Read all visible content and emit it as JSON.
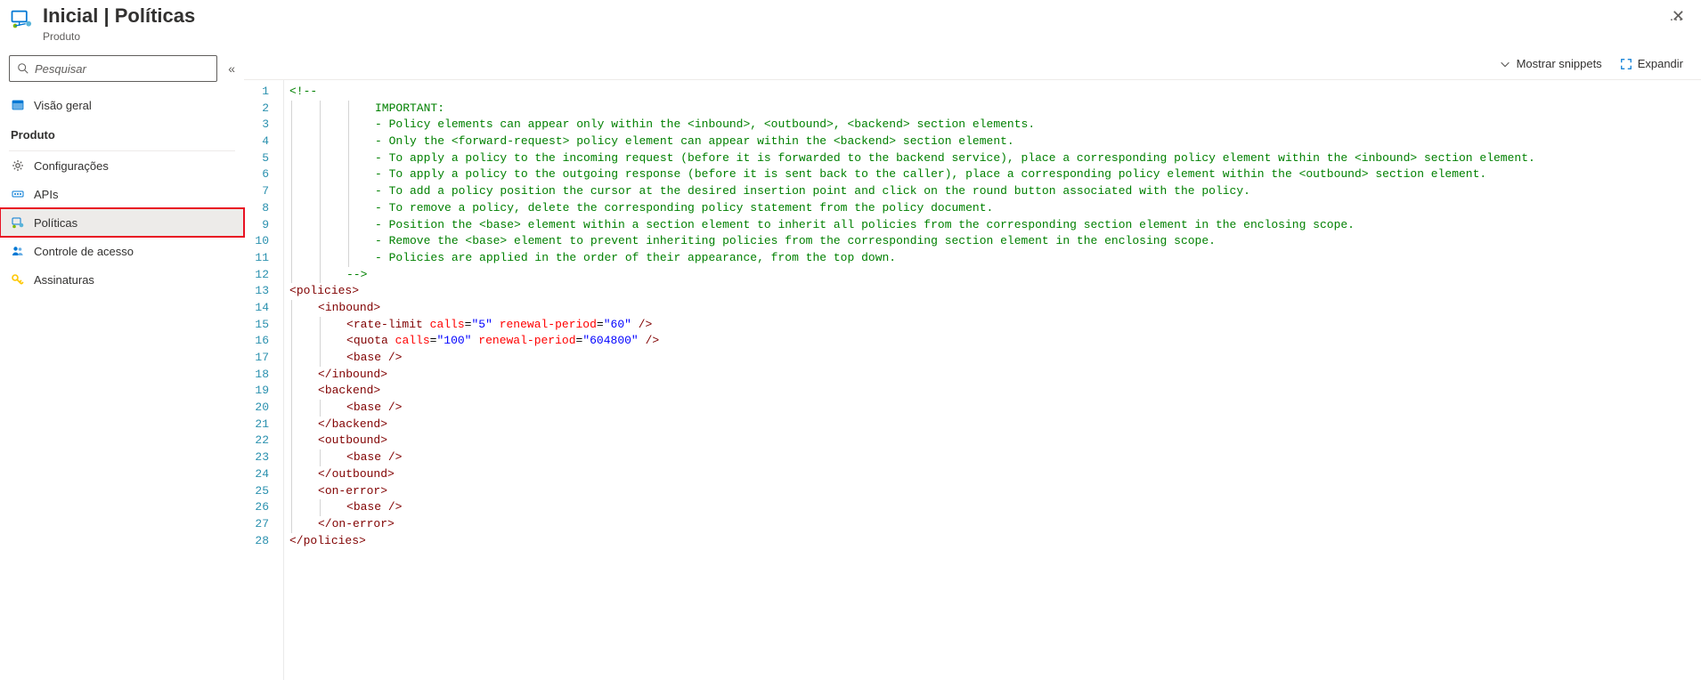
{
  "header": {
    "title": "Inicial | Políticas",
    "subtitle": "Produto",
    "more": "…"
  },
  "search": {
    "placeholder": "Pesquisar"
  },
  "sidebar": {
    "overview": "Visão geral",
    "sectionHeader": "Produto",
    "items": {
      "config": "Configurações",
      "apis": "APIs",
      "policies": "Políticas",
      "access": "Controle de acesso",
      "subs": "Assinaturas"
    }
  },
  "toolbar": {
    "snippets": "Mostrar snippets",
    "expand": "Expandir"
  },
  "editor": {
    "lineCount": 28,
    "lines": [
      {
        "indent": 0,
        "tokens": [
          {
            "t": "comment",
            "v": "<!--"
          }
        ]
      },
      {
        "indent": 3,
        "tokens": [
          {
            "t": "comment",
            "v": "IMPORTANT:"
          }
        ]
      },
      {
        "indent": 3,
        "tokens": [
          {
            "t": "comment",
            "v": "- Policy elements can appear only within the <inbound>, <outbound>, <backend> section elements."
          }
        ]
      },
      {
        "indent": 3,
        "tokens": [
          {
            "t": "comment",
            "v": "- Only the <forward-request> policy element can appear within the <backend> section element."
          }
        ]
      },
      {
        "indent": 3,
        "tokens": [
          {
            "t": "comment",
            "v": "- To apply a policy to the incoming request (before it is forwarded to the backend service), place a corresponding policy element within the <inbound> section element."
          }
        ]
      },
      {
        "indent": 3,
        "tokens": [
          {
            "t": "comment",
            "v": "- To apply a policy to the outgoing response (before it is sent back to the caller), place a corresponding policy element within the <outbound> section element."
          }
        ]
      },
      {
        "indent": 3,
        "tokens": [
          {
            "t": "comment",
            "v": "- To add a policy position the cursor at the desired insertion point and click on the round button associated with the policy."
          }
        ]
      },
      {
        "indent": 3,
        "tokens": [
          {
            "t": "comment",
            "v": "- To remove a policy, delete the corresponding policy statement from the policy document."
          }
        ]
      },
      {
        "indent": 3,
        "tokens": [
          {
            "t": "comment",
            "v": "- Position the <base> element within a section element to inherit all policies from the corresponding section element in the enclosing scope."
          }
        ]
      },
      {
        "indent": 3,
        "tokens": [
          {
            "t": "comment",
            "v": "- Remove the <base> element to prevent inheriting policies from the corresponding section element in the enclosing scope."
          }
        ]
      },
      {
        "indent": 3,
        "tokens": [
          {
            "t": "comment",
            "v": "- Policies are applied in the order of their appearance, from the top down."
          }
        ]
      },
      {
        "indent": 2,
        "tokens": [
          {
            "t": "comment",
            "v": "-->"
          }
        ]
      },
      {
        "indent": 0,
        "tokens": [
          {
            "t": "angle",
            "v": "<"
          },
          {
            "t": "tag",
            "v": "policies"
          },
          {
            "t": "angle",
            "v": ">"
          }
        ]
      },
      {
        "indent": 1,
        "tokens": [
          {
            "t": "angle",
            "v": "<"
          },
          {
            "t": "tag",
            "v": "inbound"
          },
          {
            "t": "angle",
            "v": ">"
          }
        ]
      },
      {
        "indent": 2,
        "tokens": [
          {
            "t": "angle",
            "v": "<"
          },
          {
            "t": "tag",
            "v": "rate-limit"
          },
          {
            "t": "plain",
            "v": " "
          },
          {
            "t": "attr",
            "v": "calls"
          },
          {
            "t": "eq",
            "v": "="
          },
          {
            "t": "str",
            "v": "\"5\""
          },
          {
            "t": "plain",
            "v": " "
          },
          {
            "t": "attr",
            "v": "renewal-period"
          },
          {
            "t": "eq",
            "v": "="
          },
          {
            "t": "str",
            "v": "\"60\""
          },
          {
            "t": "plain",
            "v": " "
          },
          {
            "t": "angle",
            "v": "/>"
          }
        ]
      },
      {
        "indent": 2,
        "tokens": [
          {
            "t": "angle",
            "v": "<"
          },
          {
            "t": "tag",
            "v": "quota"
          },
          {
            "t": "plain",
            "v": " "
          },
          {
            "t": "attr",
            "v": "calls"
          },
          {
            "t": "eq",
            "v": "="
          },
          {
            "t": "str",
            "v": "\"100\""
          },
          {
            "t": "plain",
            "v": " "
          },
          {
            "t": "attr",
            "v": "renewal-period"
          },
          {
            "t": "eq",
            "v": "="
          },
          {
            "t": "str",
            "v": "\"604800\""
          },
          {
            "t": "plain",
            "v": " "
          },
          {
            "t": "angle",
            "v": "/>"
          }
        ]
      },
      {
        "indent": 2,
        "tokens": [
          {
            "t": "angle",
            "v": "<"
          },
          {
            "t": "tag",
            "v": "base"
          },
          {
            "t": "plain",
            "v": " "
          },
          {
            "t": "angle",
            "v": "/>"
          }
        ]
      },
      {
        "indent": 1,
        "tokens": [
          {
            "t": "angle",
            "v": "</"
          },
          {
            "t": "tag",
            "v": "inbound"
          },
          {
            "t": "angle",
            "v": ">"
          }
        ]
      },
      {
        "indent": 1,
        "tokens": [
          {
            "t": "angle",
            "v": "<"
          },
          {
            "t": "tag",
            "v": "backend"
          },
          {
            "t": "angle",
            "v": ">"
          }
        ]
      },
      {
        "indent": 2,
        "tokens": [
          {
            "t": "angle",
            "v": "<"
          },
          {
            "t": "tag",
            "v": "base"
          },
          {
            "t": "plain",
            "v": " "
          },
          {
            "t": "angle",
            "v": "/>"
          }
        ]
      },
      {
        "indent": 1,
        "tokens": [
          {
            "t": "angle",
            "v": "</"
          },
          {
            "t": "tag",
            "v": "backend"
          },
          {
            "t": "angle",
            "v": ">"
          }
        ]
      },
      {
        "indent": 1,
        "tokens": [
          {
            "t": "angle",
            "v": "<"
          },
          {
            "t": "tag",
            "v": "outbound"
          },
          {
            "t": "angle",
            "v": ">"
          }
        ]
      },
      {
        "indent": 2,
        "tokens": [
          {
            "t": "angle",
            "v": "<"
          },
          {
            "t": "tag",
            "v": "base"
          },
          {
            "t": "plain",
            "v": " "
          },
          {
            "t": "angle",
            "v": "/>"
          }
        ]
      },
      {
        "indent": 1,
        "tokens": [
          {
            "t": "angle",
            "v": "</"
          },
          {
            "t": "tag",
            "v": "outbound"
          },
          {
            "t": "angle",
            "v": ">"
          }
        ]
      },
      {
        "indent": 1,
        "tokens": [
          {
            "t": "angle",
            "v": "<"
          },
          {
            "t": "tag",
            "v": "on-error"
          },
          {
            "t": "angle",
            "v": ">"
          }
        ]
      },
      {
        "indent": 2,
        "tokens": [
          {
            "t": "angle",
            "v": "<"
          },
          {
            "t": "tag",
            "v": "base"
          },
          {
            "t": "plain",
            "v": " "
          },
          {
            "t": "angle",
            "v": "/>"
          }
        ]
      },
      {
        "indent": 1,
        "tokens": [
          {
            "t": "angle",
            "v": "</"
          },
          {
            "t": "tag",
            "v": "on-error"
          },
          {
            "t": "angle",
            "v": ">"
          }
        ]
      },
      {
        "indent": 0,
        "tokens": [
          {
            "t": "angle",
            "v": "</"
          },
          {
            "t": "tag",
            "v": "policies"
          },
          {
            "t": "angle",
            "v": ">"
          }
        ]
      }
    ]
  }
}
